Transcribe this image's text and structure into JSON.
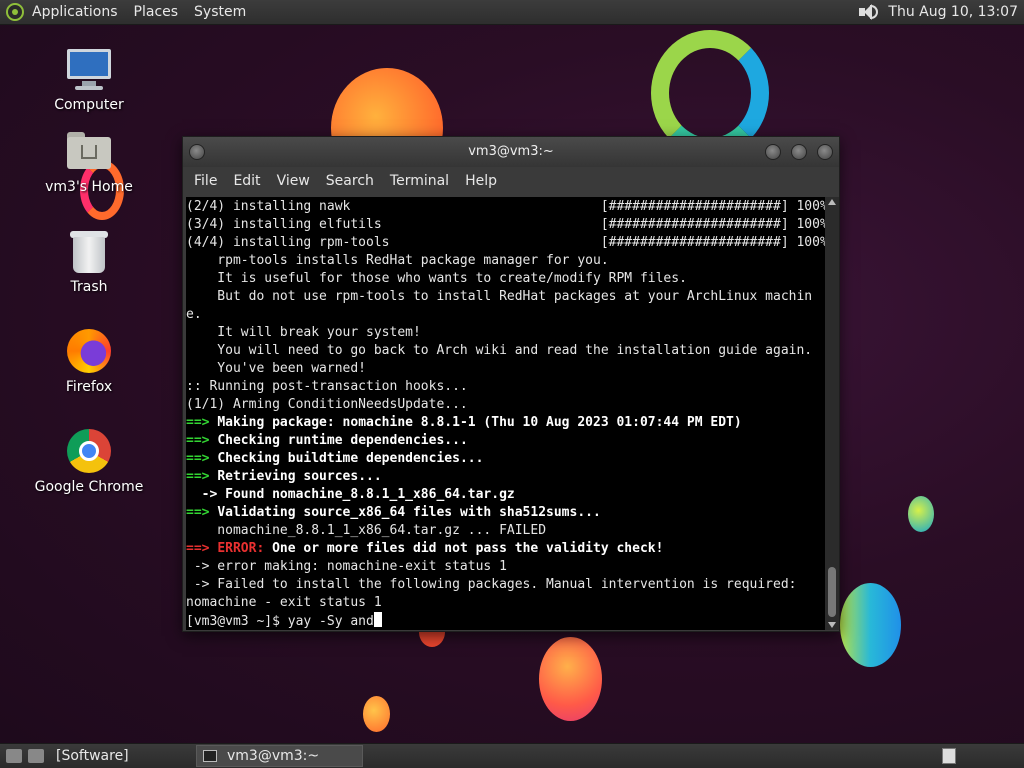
{
  "top_panel": {
    "menus": [
      "Applications",
      "Places",
      "System"
    ],
    "clock": "Thu Aug 10, 13:07"
  },
  "desktop_icons": {
    "computer": "Computer",
    "home": "vm3's Home",
    "trash": "Trash",
    "firefox": "Firefox",
    "chrome": "Google Chrome"
  },
  "terminal": {
    "title": "vm3@vm3:~",
    "menu": [
      "File",
      "Edit",
      "View",
      "Search",
      "Terminal",
      "Help"
    ],
    "lines": {
      "l1": "(2/4) installing nawk                                [######################] 100%",
      "l2": "(3/4) installing elfutils                            [######################] 100%",
      "l3": "(4/4) installing rpm-tools                           [######################] 100%",
      "l4": "    rpm-tools installs RedHat package manager for you.",
      "l5": "    It is useful for those who wants to create/modify RPM files.",
      "l6": "    But do not use rpm-tools to install RedHat packages at your ArchLinux machin",
      "l7": "e.",
      "l8": "    It will break your system!",
      "l9": "    You will need to go back to Arch wiki and read the installation guide again.",
      "l10": "    You've been warned!",
      "l11": ":: Running post-transaction hooks...",
      "l12": "(1/1) Arming ConditionNeedsUpdate...",
      "arrow": "==>",
      "l13": "Making package: nomachine 8.8.1-1 (Thu 10 Aug 2023 01:07:44 PM EDT)",
      "l14": "Checking runtime dependencies...",
      "l15": "Checking buildtime dependencies...",
      "l16": "Retrieving sources...",
      "l17": "  -> Found nomachine_8.8.1_1_x86_64.tar.gz",
      "l18": "Validating source_x86_64 files with sha512sums...",
      "l19": "    nomachine_8.8.1_1_x86_64.tar.gz ... FAILED",
      "error_label": "ERROR:",
      "l20": "One or more files did not pass the validity check!",
      "l21": " -> error making: nomachine-exit status 1",
      "l22": " -> Failed to install the following packages. Manual intervention is required:",
      "l23": "nomachine - exit status 1",
      "prompt": "[vm3@vm3 ~]$ yay -Sy and"
    }
  },
  "taskbar": {
    "software": "[Software]",
    "terminal": "vm3@vm3:~"
  }
}
